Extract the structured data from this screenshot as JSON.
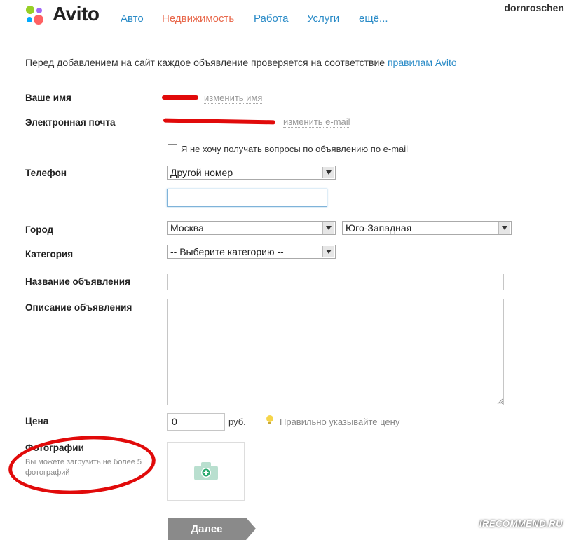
{
  "header": {
    "logo_text": "Avito",
    "nav": [
      {
        "label": "Авто"
      },
      {
        "label": "Недвижимость"
      },
      {
        "label": "Работа"
      },
      {
        "label": "Услуги"
      },
      {
        "label": "ещё..."
      }
    ],
    "username": "dornroschen",
    "colors": {
      "link": "#2a8bc7",
      "active": "#e8674a",
      "logo_dots": [
        "#97cf26",
        "#a169f7",
        "#ff6163",
        "#00aaff"
      ]
    }
  },
  "intro": {
    "text": "Перед добавлением на сайт каждое объявление проверяется на соответствие ",
    "link": "правилам Avito"
  },
  "form": {
    "name_label": "Ваше имя",
    "change_name": "изменить имя",
    "email_label": "Электронная почта",
    "change_email": "изменить e-mail",
    "no_questions_label": "Я не хочу получать вопросы по объявлению по e-mail",
    "no_questions_checked": false,
    "phone_label": "Телефон",
    "phone_select": "Другой номер",
    "phone_value": "",
    "city_label": "Город",
    "city_select": "Москва",
    "district_select": "Юго-Западная",
    "category_label": "Категория",
    "category_select": "-- Выберите категорию --",
    "title_label": "Название объявления",
    "title_value": "",
    "description_label": "Описание объявления",
    "description_value": "",
    "price_label": "Цена",
    "price_value": "0",
    "currency": "руб.",
    "price_hint": "Правильно указывайте цену",
    "photos_label": "Фотографии",
    "photos_hint": "Вы можете загрузить не более 5 фотографий",
    "next_button": "Далее"
  },
  "watermark": "IRECOMMEND.RU",
  "accent_red": "#e10a0a"
}
